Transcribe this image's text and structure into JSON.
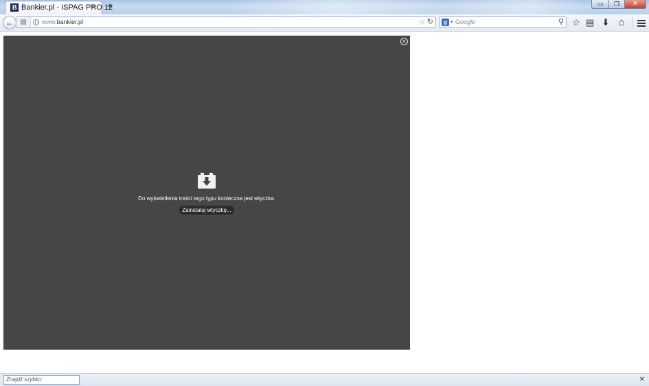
{
  "window": {
    "minimize_glyph": "▭",
    "maximize_glyph": "❐",
    "close_glyph": "✕"
  },
  "tabs": [
    {
      "favicon_letter": "B",
      "title": "Bankier.pl - ISPAG PRO 12",
      "close_glyph": "✕"
    }
  ],
  "new_tab_glyph": "+",
  "navbar": {
    "back_glyph": "←",
    "url_prefix": "www.",
    "url_host": "bankier.pl",
    "url_dropmarker": "▽",
    "reload_glyph": "↻",
    "search": {
      "engine_letter": "g",
      "engine_dropmarker": "▾",
      "placeholder": "Google",
      "go_glyph": "⚲"
    },
    "bookmark_glyph": "☆",
    "bookmarks_menu_glyph": "▤",
    "downloads_glyph": "⬇",
    "home_glyph": "⌂"
  },
  "plugin": {
    "close_glyph": "✕",
    "message": "Do wyświetlenia treści tego typu konieczna jest wtyczka.",
    "install_label": "Zainstaluj wtyczkę..."
  },
  "findbar": {
    "placeholder": "Znajdź szybko:",
    "close_glyph": "✕"
  },
  "colors": {
    "plugin_background": "#464646",
    "install_button": "#2b2b2b",
    "favicon": "#1b2a57"
  }
}
